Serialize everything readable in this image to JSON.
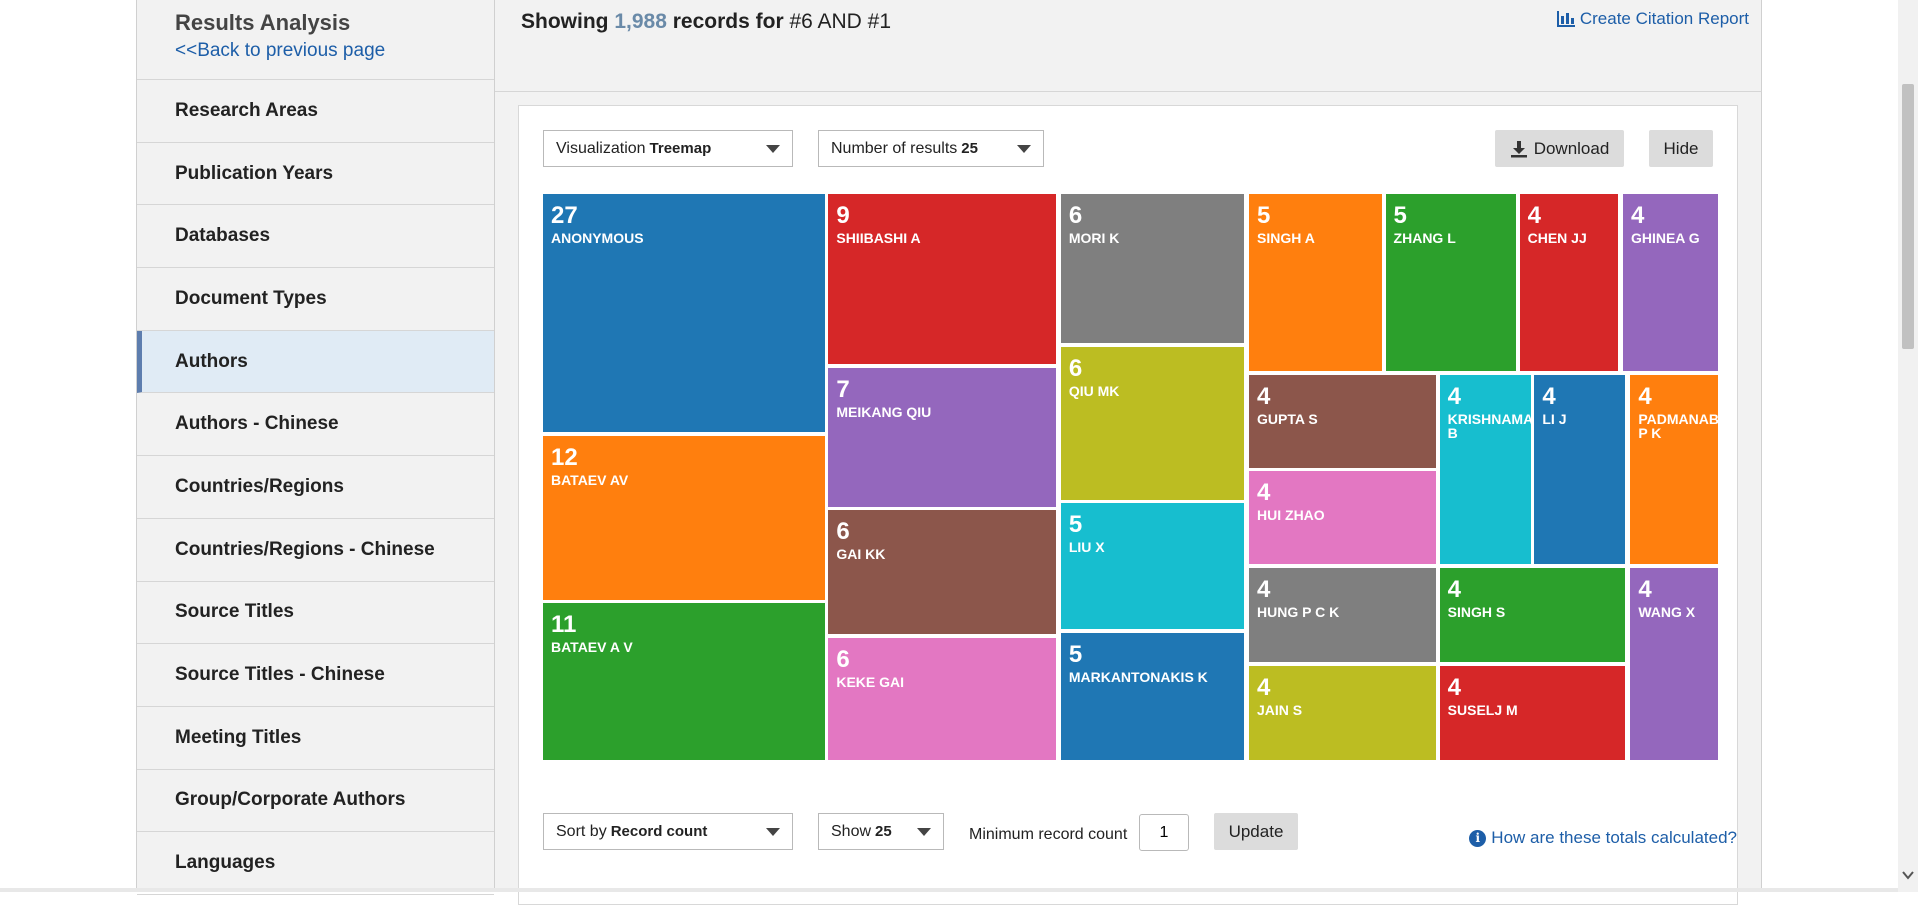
{
  "sidebar": {
    "title": "Results Analysis",
    "back_link": "<<Back to previous page",
    "items": [
      {
        "label": "Research Areas",
        "active": false
      },
      {
        "label": "Publication Years",
        "active": false
      },
      {
        "label": "Databases",
        "active": false
      },
      {
        "label": "Document Types",
        "active": false
      },
      {
        "label": "Authors",
        "active": true
      },
      {
        "label": "Authors - Chinese",
        "active": false
      },
      {
        "label": "Countries/Regions",
        "active": false
      },
      {
        "label": "Countries/Regions - Chinese",
        "active": false
      },
      {
        "label": "Source Titles",
        "active": false
      },
      {
        "label": "Source Titles - Chinese",
        "active": false
      },
      {
        "label": "Meeting Titles",
        "active": false
      },
      {
        "label": "Group/Corporate Authors",
        "active": false
      },
      {
        "label": "Languages",
        "active": false
      }
    ]
  },
  "header": {
    "showing_prefix": "Showing",
    "record_count": "1,988",
    "records_for": "records for",
    "query": "#6 AND #1",
    "citation_report": "Create Citation Report"
  },
  "controls": {
    "visualization_label": "Visualization",
    "visualization_value": "Treemap",
    "num_results_label": "Number of results",
    "num_results_value": "25",
    "download": "Download",
    "hide": "Hide"
  },
  "treemap": [
    {
      "count": "27",
      "name": "ANONYMOUS",
      "color": "#1f77b4"
    },
    {
      "count": "12",
      "name": "BATAEV AV",
      "color": "#ff7f0e"
    },
    {
      "count": "11",
      "name": "BATAEV A V",
      "color": "#2ca02c"
    },
    {
      "count": "9",
      "name": "SHIIBASHI A",
      "color": "#d62728"
    },
    {
      "count": "7",
      "name": "MEIKANG QIU",
      "color": "#9467bd"
    },
    {
      "count": "6",
      "name": "GAI KK",
      "color": "#8c564b"
    },
    {
      "count": "6",
      "name": "KEKE GAI",
      "color": "#e377c2"
    },
    {
      "count": "6",
      "name": "MORI K",
      "color": "#7f7f7f"
    },
    {
      "count": "6",
      "name": "QIU MK",
      "color": "#bcbd22"
    },
    {
      "count": "5",
      "name": "LIU X",
      "color": "#17becf"
    },
    {
      "count": "5",
      "name": "MARKANTONAKIS K",
      "color": "#1f77b4"
    },
    {
      "count": "5",
      "name": "SINGH A",
      "color": "#ff7f0e"
    },
    {
      "count": "5",
      "name": "ZHANG L",
      "color": "#2ca02c"
    },
    {
      "count": "4",
      "name": "CHEN JJ",
      "color": "#d62728"
    },
    {
      "count": "4",
      "name": "GHINEA G",
      "color": "#9467bd"
    },
    {
      "count": "4",
      "name": "GUPTA S",
      "color": "#8c564b"
    },
    {
      "count": "4",
      "name": "HUI ZHAO",
      "color": "#e377c2"
    },
    {
      "count": "4",
      "name": "HUNG P C K",
      "color": "#7f7f7f"
    },
    {
      "count": "4",
      "name": "JAIN S",
      "color": "#bcbd22"
    },
    {
      "count": "4",
      "name": "KRISHNAMA B",
      "color": "#17becf"
    },
    {
      "count": "4",
      "name": "LI J",
      "color": "#1f77b4"
    },
    {
      "count": "4",
      "name": "PADMANAB P K",
      "color": "#ff7f0e"
    },
    {
      "count": "4",
      "name": "SINGH S",
      "color": "#2ca02c"
    },
    {
      "count": "4",
      "name": "SUSELJ M",
      "color": "#d62728"
    },
    {
      "count": "4",
      "name": "WANG X",
      "color": "#9467bd"
    }
  ],
  "bottom": {
    "sort_label": "Sort by",
    "sort_value": "Record count",
    "show_label": "Show",
    "show_value": "25",
    "min_label": "Minimum record count",
    "min_value": "1",
    "update": "Update",
    "help": "How are these totals calculated?"
  }
}
